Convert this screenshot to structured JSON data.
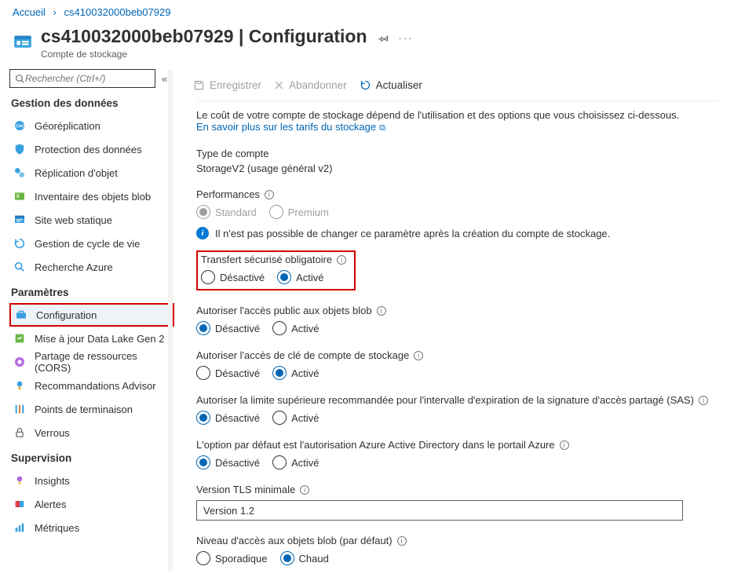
{
  "breadcrumb": {
    "home": "Accueil",
    "resource": "cs410032000beb07929"
  },
  "header": {
    "title_resource": "cs410032000beb07929",
    "title_page": "Configuration",
    "subtitle": "Compte de stockage"
  },
  "sidebar": {
    "search_placeholder": "Rechercher (Ctrl+/)",
    "sections": {
      "data_mgmt": "Gestion des données",
      "settings": "Paramètres",
      "monitoring": "Supervision"
    },
    "items": {
      "georeplication": "Géoréplication",
      "data_protection": "Protection des données",
      "object_replication": "Réplication d'objet",
      "blob_inventory": "Inventaire des objets blob",
      "static_website": "Site web statique",
      "lifecycle": "Gestion de cycle de vie",
      "azure_search": "Recherche Azure",
      "configuration": "Configuration",
      "dlg2": "Mise à jour Data Lake Gen 2",
      "cors": "Partage de ressources (CORS)",
      "advisor": "Recommandations Advisor",
      "endpoints": "Points de terminaison",
      "locks": "Verrous",
      "insights": "Insights",
      "alerts": "Alertes",
      "metrics": "Métriques"
    }
  },
  "toolbar": {
    "save": "Enregistrer",
    "discard": "Abandonner",
    "refresh": "Actualiser"
  },
  "content": {
    "cost_info": "Le coût de votre compte de stockage dépend de l'utilisation et des options que vous choisissez ci-dessous.",
    "pricing_link": "En savoir plus sur les tarifs du stockage",
    "account_type_label": "Type de compte",
    "account_type_value": "StorageV2 (usage général v2)",
    "performance_label": "Performances",
    "perf_standard": "Standard",
    "perf_premium": "Premium",
    "perf_note": "Il n'est pas possible de changer ce paramètre après la création du compte de stockage.",
    "secure_transfer_label": "Transfert sécurisé obligatoire",
    "disabled": "Désactivé",
    "enabled": "Activé",
    "blob_public_label": "Autoriser l'accès public aux objets blob",
    "key_access_label": "Autoriser l'accès de clé de compte de stockage",
    "sas_limit_label": "Autoriser la limite supérieure recommandée pour l'intervalle d'expiration de la signature d'accès partagé (SAS)",
    "aad_default_label": "L'option par défaut est l'autorisation Azure Active Directory dans le portail Azure",
    "tls_label": "Version TLS minimale",
    "tls_value": "Version 1.2",
    "access_tier_label": "Niveau d'accès aux objets blob (par défaut)",
    "tier_cool": "Sporadique",
    "tier_hot": "Chaud"
  }
}
